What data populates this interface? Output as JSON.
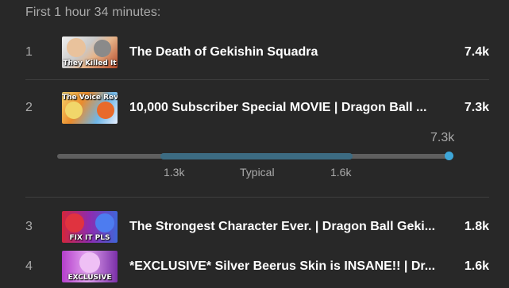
{
  "header": {
    "text": "First 1 hour 34 minutes:"
  },
  "videos": [
    {
      "rank": "1",
      "thumb_caption": "They Killed It",
      "title": "The Death of Gekishin Squadra",
      "views": "7.4k",
      "thumb_icon": "video-thumbnail"
    },
    {
      "rank": "2",
      "thumb_caption": "The Voice Reveal",
      "title": "10,000 Subscriber Special MOVIE | Dragon Ball ...",
      "views": "7.3k",
      "thumb_icon": "video-thumbnail"
    },
    {
      "rank": "3",
      "thumb_caption": "FIX IT PLS",
      "title": "The Strongest Character Ever. | Dragon Ball Geki...",
      "views": "1.8k",
      "thumb_icon": "video-thumbnail"
    },
    {
      "rank": "4",
      "thumb_caption": "EXCLUSIVE",
      "title": "*EXCLUSIVE* Silver Beerus Skin is INSANE!! | Dr...",
      "views": "1.6k",
      "thumb_icon": "video-thumbnail"
    }
  ],
  "range": {
    "current_label": "7.3k",
    "low_label": "1.3k",
    "typical_label": "Typical",
    "high_label": "1.6k",
    "colors": {
      "typical_band": "#3c6b82",
      "marker": "#3ea6d8",
      "track": "#5f5f5f"
    }
  }
}
